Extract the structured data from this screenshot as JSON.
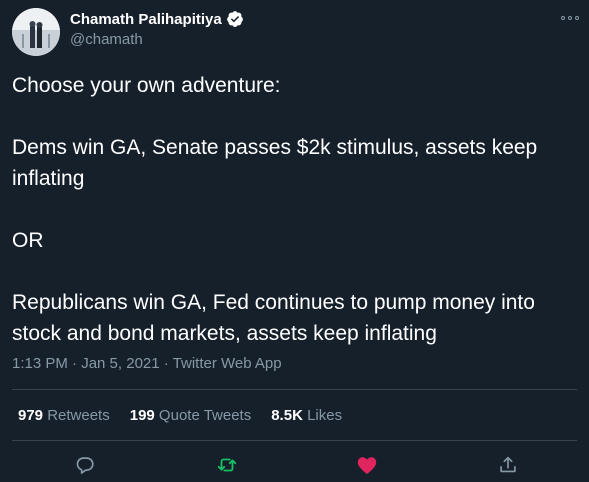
{
  "author": {
    "display_name": "Chamath Palihapitiya",
    "handle": "@chamath",
    "verified": true
  },
  "tweet": {
    "lines": [
      "Choose your own adventure:",
      "",
      "Dems win GA, Senate passes $2k stimulus, assets keep",
      "inflating",
      "",
      "OR",
      "",
      "Republicans win GA, Fed continues to pump money into",
      "stock and bond markets, assets keep inflating"
    ],
    "time": "1:13 PM · Jan 5, 2021 · ",
    "source": "Twitter Web App"
  },
  "stats": {
    "retweets_count": "979",
    "retweets_label": " Retweets",
    "quotes_count": "199",
    "quotes_label": " Quote Tweets",
    "likes_count": "8.5K",
    "likes_label": " Likes"
  },
  "actions": {
    "reply": "reply-icon",
    "retweet": "retweet-icon",
    "like": "heart-icon",
    "share": "share-icon"
  },
  "colors": {
    "background": "#15202b",
    "text_primary": "#ffffff",
    "text_secondary": "#8899a6",
    "divider": "#38444d",
    "retweet_active": "#17bf63",
    "like_active": "#e0245e",
    "verified": "#ffffff"
  }
}
